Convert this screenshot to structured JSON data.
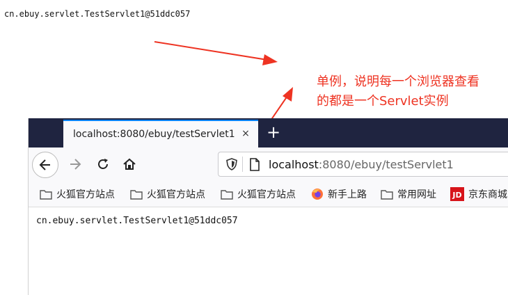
{
  "console_output": "cn.ebuy.servlet.TestServlet1@51ddc057",
  "annotation": {
    "line1": "单例，说明每一个浏览器查看",
    "line2": "的都是一个Servlet实例",
    "color": "#ee3322"
  },
  "browser": {
    "tab_title": "localhost:8080/ebuy/testServlet1",
    "tab_close": "×",
    "new_tab": "+",
    "url_host": "localhost",
    "url_rest": ":8080/ebuy/testServlet1",
    "bookmarks": [
      {
        "label": "火狐官方站点",
        "icon": "folder-icon"
      },
      {
        "label": "火狐官方站点",
        "icon": "folder-icon"
      },
      {
        "label": "火狐官方站点",
        "icon": "folder-icon"
      },
      {
        "label": "新手上路",
        "icon": "firefox-icon"
      },
      {
        "label": "常用网址",
        "icon": "folder-icon"
      },
      {
        "label": "京东商城",
        "icon": "jd-icon"
      }
    ],
    "page_output": "cn.ebuy.servlet.TestServlet1@51ddc057"
  },
  "colors": {
    "tabbar_bg": "#1f2440",
    "active_tab_accent": "#0a84ff",
    "annotation_red": "#ee3322"
  }
}
